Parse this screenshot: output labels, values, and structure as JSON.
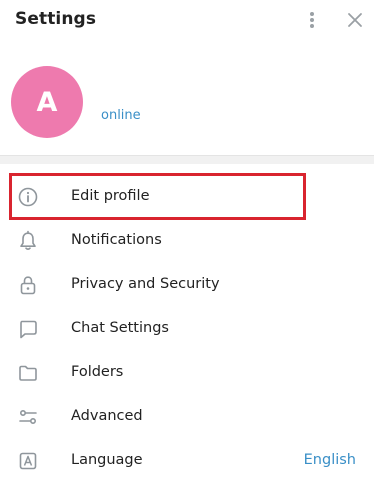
{
  "header": {
    "title": "Settings"
  },
  "profile": {
    "avatar_initial": "A",
    "status": "online",
    "avatar_color": "#ee7aae",
    "status_color": "#3a8fc7"
  },
  "menu": {
    "items": [
      {
        "label": "Edit profile",
        "icon": "info-icon"
      },
      {
        "label": "Notifications",
        "icon": "bell-icon"
      },
      {
        "label": "Privacy and Security",
        "icon": "lock-icon"
      },
      {
        "label": "Chat Settings",
        "icon": "chat-bubble-icon"
      },
      {
        "label": "Folders",
        "icon": "folder-icon"
      },
      {
        "label": "Advanced",
        "icon": "sliders-icon"
      },
      {
        "label": "Language",
        "icon": "language-icon",
        "value": "English"
      }
    ]
  },
  "colors": {
    "highlight": "#d9242f",
    "accent": "#3a8fc7",
    "icon": "#8f969c"
  }
}
